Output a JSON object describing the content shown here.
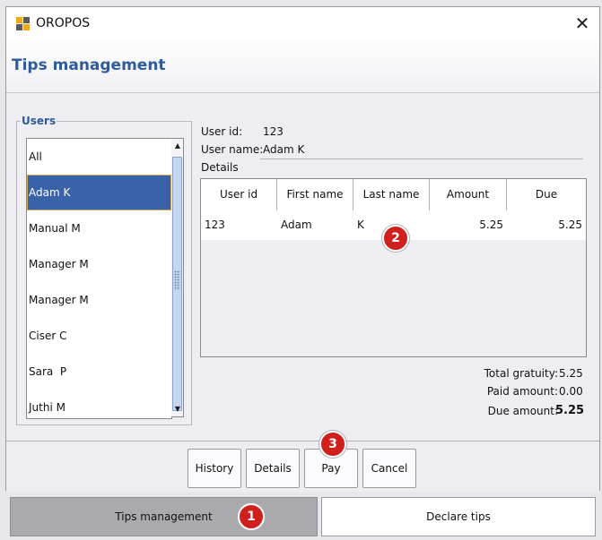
{
  "window": {
    "title": "OROPOS"
  },
  "page_title": "Tips management",
  "users": {
    "legend": "Users",
    "items": [
      {
        "label": "All",
        "selected": false
      },
      {
        "label": "Adam K",
        "selected": true
      },
      {
        "label": "Manual M",
        "selected": false
      },
      {
        "label": "Manager M",
        "selected": false
      },
      {
        "label": "Manager M",
        "selected": false
      },
      {
        "label": "Ciser C",
        "selected": false
      },
      {
        "label": "Sara  P",
        "selected": false
      },
      {
        "label": "Juthi M",
        "selected": false
      }
    ]
  },
  "info": {
    "user_id_label": "User id:",
    "user_id_value": "123",
    "user_name_label": "User name:",
    "user_name_value": "Adam K",
    "details_label": "Details"
  },
  "table": {
    "headers": [
      "User id",
      "First name",
      "Last name",
      "Amount",
      "Due"
    ],
    "rows": [
      [
        "123",
        "Adam",
        "K",
        "5.25",
        "5.25"
      ]
    ]
  },
  "totals": {
    "total_gratuity_label": "Total gratuity:",
    "total_gratuity_value": "5.25",
    "paid_amount_label": "Paid amount:",
    "paid_amount_value": "0.00",
    "due_amount_label": "Due amount:",
    "due_amount_value": "5.25"
  },
  "buttons": {
    "history": "History",
    "details": "Details",
    "pay": "Pay",
    "cancel": "Cancel"
  },
  "bottom_tabs": {
    "tips_management": "Tips management",
    "declare_tips": "Declare tips"
  },
  "badges": {
    "one": "1",
    "two": "2",
    "three": "3"
  },
  "colors": {
    "accent": "#2f5a9c",
    "selection": "#3a62a8",
    "badge": "#d0201e"
  },
  "icons": {
    "app": "oropos-logo-icon",
    "close": "close-icon",
    "scroll_up": "scroll-up-arrow-icon",
    "scroll_down": "scroll-down-arrow-icon"
  }
}
